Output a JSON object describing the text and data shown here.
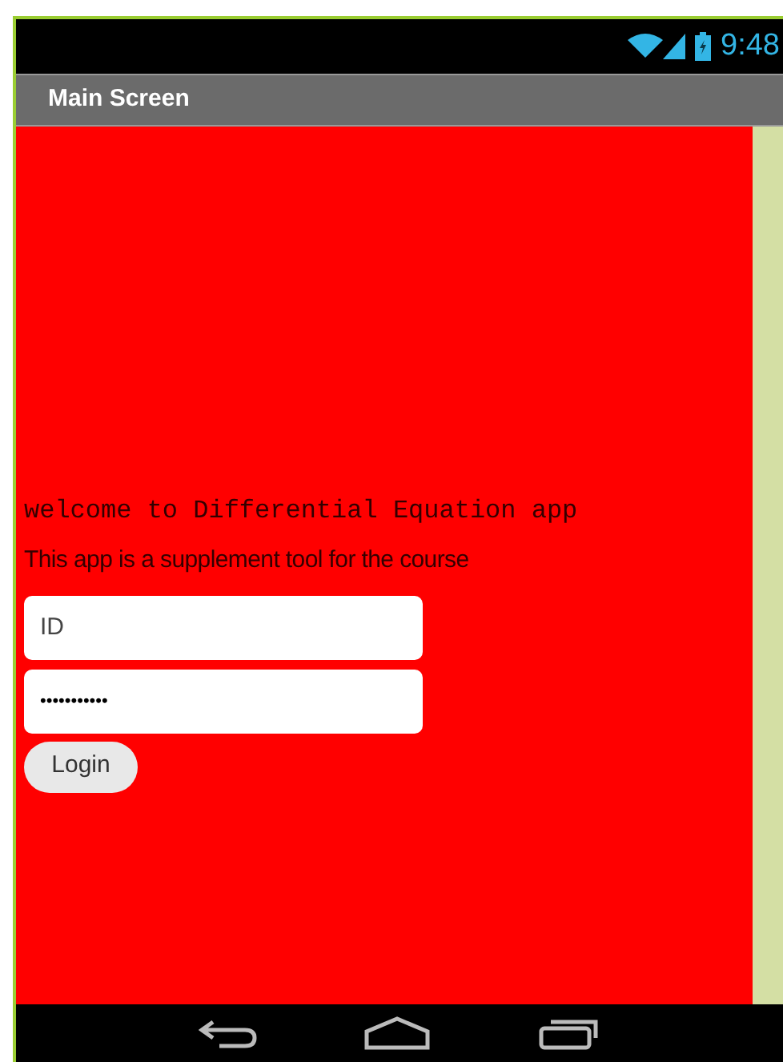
{
  "status_bar": {
    "time": "9:48"
  },
  "title_bar": {
    "title": "Main Screen"
  },
  "welcome": "welcome to Differential Equation app",
  "subtitle": "This app is a supplement tool for the course",
  "id_field": {
    "value": "ID"
  },
  "password_field": {
    "value": "•••••••••••"
  },
  "login_button": "Login"
}
